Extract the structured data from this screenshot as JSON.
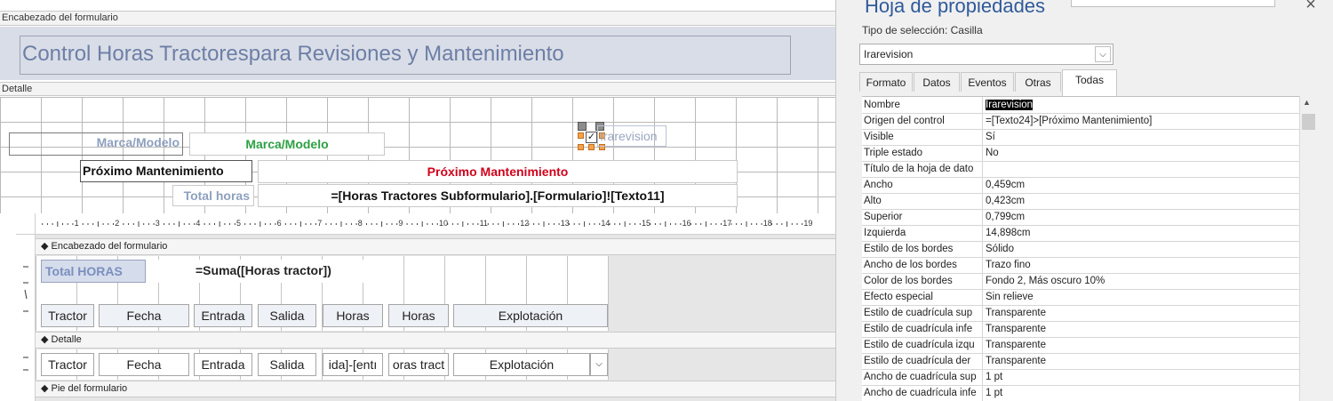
{
  "designer": {
    "sections": {
      "form_header": "Encabezado del formulario",
      "detail": "Detalle"
    },
    "form_title": "Control Horas Tractorespara Revisiones y Mantenimiento",
    "controls": {
      "marca_label": "Marca/Modelo",
      "marca_field": "Marca/Modelo",
      "proximo_label": "Próximo Mantenimiento",
      "proximo_field": "Próximo Mantenimiento",
      "total_label": "Total horas",
      "total_field": "=[Horas Tractores Subformulario].[Formulario]![Texto11]",
      "checkbox_label": "Irarevision"
    },
    "colors": {
      "marca_field": "#2ea043",
      "proximo_field": "#d0021b"
    }
  },
  "subform": {
    "ruler_ticks": [
      "1",
      "2",
      "3",
      "4",
      "5",
      "6",
      "7",
      "8",
      "9",
      "10",
      "11",
      "12",
      "13",
      "14",
      "15",
      "16",
      "17",
      "18",
      "19"
    ],
    "sections": {
      "header": "Encabezado del formulario",
      "detail": "Detalle",
      "footer": "Pie del formulario"
    },
    "total_label": "Total HORAS",
    "total_field": "=Suma([Horas tractor])",
    "header_cells": [
      "Tractor",
      "Fecha",
      "Entrada",
      "Salida",
      "Horas",
      "Horas",
      "Explotación"
    ],
    "detail_cells": [
      "Tractor",
      "Fecha",
      "Entrada",
      "Salida",
      "ida]-[entı",
      "oras tract",
      "Explotación"
    ]
  },
  "property_sheet": {
    "title": "Hoja de propiedades",
    "selection_type": "Tipo de selección:  Casilla",
    "selected_object": "Irarevision",
    "close_icon": "×",
    "tabs": [
      "Formato",
      "Datos",
      "Eventos",
      "Otras",
      "Todas"
    ],
    "active_tab": "Todas",
    "rows": [
      {
        "name": "Nombre",
        "value": "Irarevision"
      },
      {
        "name": "Origen del control",
        "value": "=[Texto24]>[Próximo Mantenimiento]"
      },
      {
        "name": "Visible",
        "value": "Sí"
      },
      {
        "name": "Triple estado",
        "value": "No"
      },
      {
        "name": "Título de la hoja de dato",
        "value": ""
      },
      {
        "name": "Ancho",
        "value": "0,459cm"
      },
      {
        "name": "Alto",
        "value": "0,423cm"
      },
      {
        "name": "Superior",
        "value": "0,799cm"
      },
      {
        "name": "Izquierda",
        "value": "14,898cm"
      },
      {
        "name": "Estilo de los bordes",
        "value": "Sólido"
      },
      {
        "name": "Ancho de los bordes",
        "value": "Trazo fino"
      },
      {
        "name": "Color de los bordes",
        "value": "Fondo 2, Más oscuro 10%"
      },
      {
        "name": "Efecto especial",
        "value": "Sin relieve"
      },
      {
        "name": "Estilo de cuadrícula sup",
        "value": "Transparente"
      },
      {
        "name": "Estilo de cuadrícula infe",
        "value": "Transparente"
      },
      {
        "name": "Estilo de cuadrícula izqu",
        "value": "Transparente"
      },
      {
        "name": "Estilo de cuadrícula der",
        "value": "Transparente"
      },
      {
        "name": "Ancho de cuadrícula sup",
        "value": "1 pt"
      },
      {
        "name": "Ancho de cuadrícula infe",
        "value": "1 pt"
      }
    ]
  }
}
